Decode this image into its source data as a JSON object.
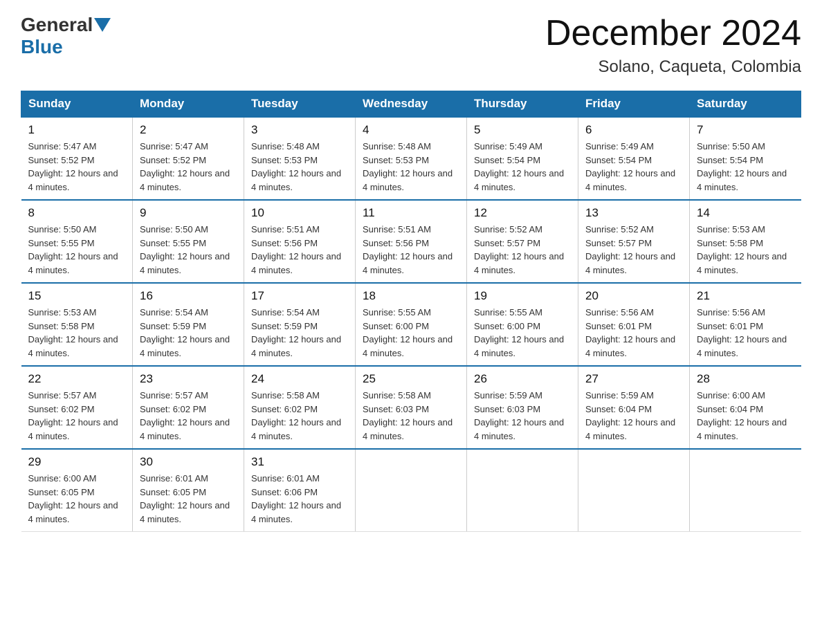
{
  "header": {
    "logo": {
      "general": "General",
      "blue": "Blue"
    },
    "title": "December 2024",
    "subtitle": "Solano, Caqueta, Colombia"
  },
  "weekdays": [
    "Sunday",
    "Monday",
    "Tuesday",
    "Wednesday",
    "Thursday",
    "Friday",
    "Saturday"
  ],
  "weeks": [
    [
      {
        "day": "1",
        "sunrise": "5:47 AM",
        "sunset": "5:52 PM",
        "daylight": "12 hours and 4 minutes."
      },
      {
        "day": "2",
        "sunrise": "5:47 AM",
        "sunset": "5:52 PM",
        "daylight": "12 hours and 4 minutes."
      },
      {
        "day": "3",
        "sunrise": "5:48 AM",
        "sunset": "5:53 PM",
        "daylight": "12 hours and 4 minutes."
      },
      {
        "day": "4",
        "sunrise": "5:48 AM",
        "sunset": "5:53 PM",
        "daylight": "12 hours and 4 minutes."
      },
      {
        "day": "5",
        "sunrise": "5:49 AM",
        "sunset": "5:54 PM",
        "daylight": "12 hours and 4 minutes."
      },
      {
        "day": "6",
        "sunrise": "5:49 AM",
        "sunset": "5:54 PM",
        "daylight": "12 hours and 4 minutes."
      },
      {
        "day": "7",
        "sunrise": "5:50 AM",
        "sunset": "5:54 PM",
        "daylight": "12 hours and 4 minutes."
      }
    ],
    [
      {
        "day": "8",
        "sunrise": "5:50 AM",
        "sunset": "5:55 PM",
        "daylight": "12 hours and 4 minutes."
      },
      {
        "day": "9",
        "sunrise": "5:50 AM",
        "sunset": "5:55 PM",
        "daylight": "12 hours and 4 minutes."
      },
      {
        "day": "10",
        "sunrise": "5:51 AM",
        "sunset": "5:56 PM",
        "daylight": "12 hours and 4 minutes."
      },
      {
        "day": "11",
        "sunrise": "5:51 AM",
        "sunset": "5:56 PM",
        "daylight": "12 hours and 4 minutes."
      },
      {
        "day": "12",
        "sunrise": "5:52 AM",
        "sunset": "5:57 PM",
        "daylight": "12 hours and 4 minutes."
      },
      {
        "day": "13",
        "sunrise": "5:52 AM",
        "sunset": "5:57 PM",
        "daylight": "12 hours and 4 minutes."
      },
      {
        "day": "14",
        "sunrise": "5:53 AM",
        "sunset": "5:58 PM",
        "daylight": "12 hours and 4 minutes."
      }
    ],
    [
      {
        "day": "15",
        "sunrise": "5:53 AM",
        "sunset": "5:58 PM",
        "daylight": "12 hours and 4 minutes."
      },
      {
        "day": "16",
        "sunrise": "5:54 AM",
        "sunset": "5:59 PM",
        "daylight": "12 hours and 4 minutes."
      },
      {
        "day": "17",
        "sunrise": "5:54 AM",
        "sunset": "5:59 PM",
        "daylight": "12 hours and 4 minutes."
      },
      {
        "day": "18",
        "sunrise": "5:55 AM",
        "sunset": "6:00 PM",
        "daylight": "12 hours and 4 minutes."
      },
      {
        "day": "19",
        "sunrise": "5:55 AM",
        "sunset": "6:00 PM",
        "daylight": "12 hours and 4 minutes."
      },
      {
        "day": "20",
        "sunrise": "5:56 AM",
        "sunset": "6:01 PM",
        "daylight": "12 hours and 4 minutes."
      },
      {
        "day": "21",
        "sunrise": "5:56 AM",
        "sunset": "6:01 PM",
        "daylight": "12 hours and 4 minutes."
      }
    ],
    [
      {
        "day": "22",
        "sunrise": "5:57 AM",
        "sunset": "6:02 PM",
        "daylight": "12 hours and 4 minutes."
      },
      {
        "day": "23",
        "sunrise": "5:57 AM",
        "sunset": "6:02 PM",
        "daylight": "12 hours and 4 minutes."
      },
      {
        "day": "24",
        "sunrise": "5:58 AM",
        "sunset": "6:02 PM",
        "daylight": "12 hours and 4 minutes."
      },
      {
        "day": "25",
        "sunrise": "5:58 AM",
        "sunset": "6:03 PM",
        "daylight": "12 hours and 4 minutes."
      },
      {
        "day": "26",
        "sunrise": "5:59 AM",
        "sunset": "6:03 PM",
        "daylight": "12 hours and 4 minutes."
      },
      {
        "day": "27",
        "sunrise": "5:59 AM",
        "sunset": "6:04 PM",
        "daylight": "12 hours and 4 minutes."
      },
      {
        "day": "28",
        "sunrise": "6:00 AM",
        "sunset": "6:04 PM",
        "daylight": "12 hours and 4 minutes."
      }
    ],
    [
      {
        "day": "29",
        "sunrise": "6:00 AM",
        "sunset": "6:05 PM",
        "daylight": "12 hours and 4 minutes."
      },
      {
        "day": "30",
        "sunrise": "6:01 AM",
        "sunset": "6:05 PM",
        "daylight": "12 hours and 4 minutes."
      },
      {
        "day": "31",
        "sunrise": "6:01 AM",
        "sunset": "6:06 PM",
        "daylight": "12 hours and 4 minutes."
      },
      null,
      null,
      null,
      null
    ]
  ]
}
